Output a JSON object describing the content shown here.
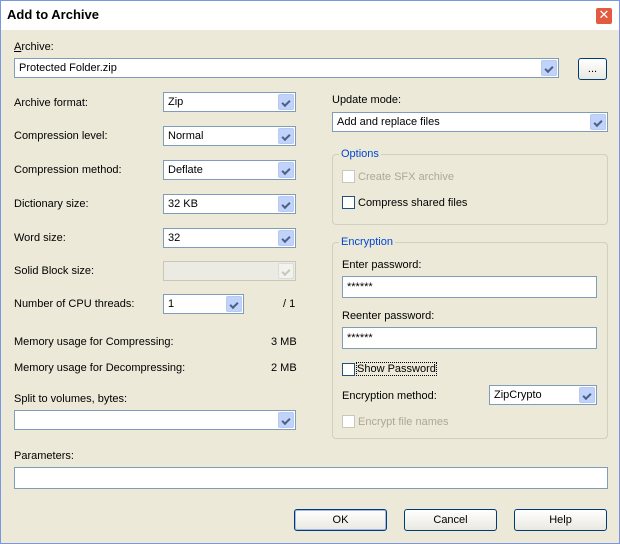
{
  "window": {
    "title": "Add to Archive"
  },
  "archive": {
    "label": "Archive:",
    "value": "Protected Folder.zip",
    "browse_label": "..."
  },
  "left": {
    "format": {
      "label": "Archive format:",
      "value": "Zip"
    },
    "level": {
      "label": "Compression level:",
      "value": "Normal"
    },
    "method": {
      "label": "Compression method:",
      "value": "Deflate"
    },
    "dictionary": {
      "label": "Dictionary size:",
      "value": "32 KB"
    },
    "word": {
      "label": "Word size:",
      "value": "32"
    },
    "solid": {
      "label": "Solid Block size:",
      "value": ""
    },
    "threads": {
      "label": "Number of CPU threads:",
      "value": "1",
      "max": "/ 1"
    },
    "mem_compress": {
      "label": "Memory usage for Compressing:",
      "value": "3 MB"
    },
    "mem_decompress": {
      "label": "Memory usage for Decompressing:",
      "value": "2 MB"
    },
    "split": {
      "label": "Split to volumes, bytes:",
      "value": ""
    }
  },
  "right": {
    "update_mode": {
      "label": "Update mode:",
      "value": "Add and replace files"
    },
    "options": {
      "title": "Options",
      "sfx": {
        "label": "Create SFX archive",
        "checked": false,
        "enabled": false
      },
      "shared": {
        "label": "Compress shared files",
        "checked": false,
        "enabled": true
      }
    },
    "encryption": {
      "title": "Encryption",
      "enter_label": "Enter password:",
      "enter_value": "******",
      "reenter_label": "Reenter password:",
      "reenter_value": "******",
      "show_password": {
        "label": "Show Password",
        "checked": false
      },
      "method_label": "Encryption method:",
      "method_value": "ZipCrypto",
      "encrypt_names": {
        "label": "Encrypt file names",
        "checked": false,
        "enabled": false
      }
    }
  },
  "parameters": {
    "label": "Parameters:",
    "value": ""
  },
  "buttons": {
    "ok": "OK",
    "cancel": "Cancel",
    "help": "Help"
  },
  "icons": {
    "close": "close-icon",
    "dropdown": "chevron-down-icon"
  }
}
